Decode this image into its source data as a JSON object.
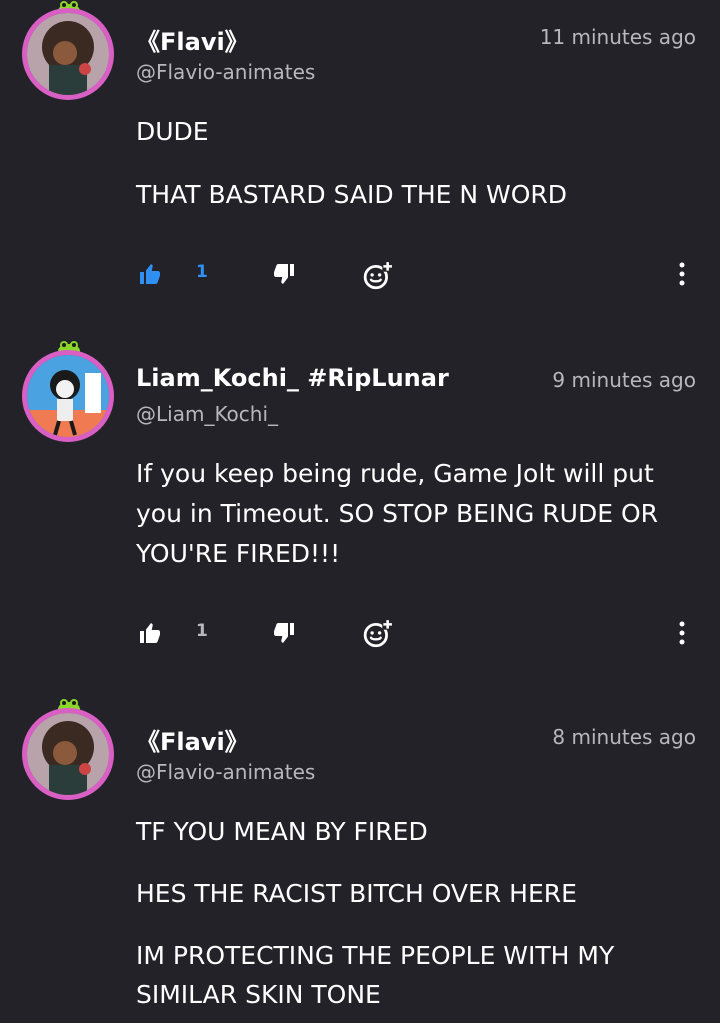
{
  "colors": {
    "background": "#232229",
    "liked_blue": "#2f8ff2",
    "muted_text": "#b9b7be",
    "avatar_ring": "#d95fc4",
    "frog_green": "#8ad62a"
  },
  "comments": [
    {
      "display_name": "《Flavi》",
      "handle": "@Flavio-animates",
      "time": "11 minutes ago",
      "lines": [
        "DUDE",
        "THAT BASTARD SAID THE N WORD"
      ],
      "like_count": "1",
      "liked": true,
      "icons": [
        "thumbs-up-icon",
        "thumbs-down-icon",
        "emoji-add-icon",
        "more-vertical-icon"
      ]
    },
    {
      "display_name": "Liam_Kochi_ #RipLunar",
      "handle": "@Liam_Kochi_",
      "time": "9 minutes ago",
      "lines": [
        "If you keep being rude, Game Jolt will put",
        "you in Timeout. SO STOP BEING RUDE OR",
        "YOU'RE FIRED!!!"
      ],
      "like_count": "1",
      "liked": false,
      "icons": [
        "thumbs-up-icon",
        "thumbs-down-icon",
        "emoji-add-icon",
        "more-vertical-icon"
      ]
    },
    {
      "display_name": "《Flavi》",
      "handle": "@Flavio-animates",
      "time": "8 minutes ago",
      "lines": [
        "TF YOU MEAN BY FIRED",
        "HES THE RACIST BITCH OVER HERE",
        "IM PROTECTING THE PEOPLE WITH MY",
        "SIMILAR SKIN TONE"
      ]
    }
  ]
}
